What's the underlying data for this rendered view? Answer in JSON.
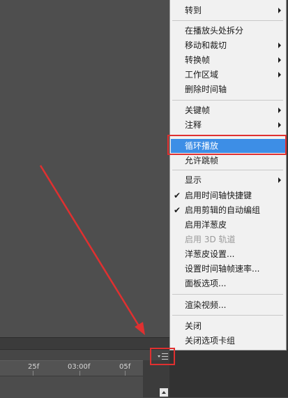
{
  "menu": {
    "groups": [
      {
        "items": [
          {
            "label": "转到",
            "submenu": true
          }
        ]
      },
      {
        "items": [
          {
            "label": "在播放头处拆分"
          },
          {
            "label": "移动和裁切",
            "submenu": true
          },
          {
            "label": "转换帧",
            "submenu": true
          },
          {
            "label": "工作区域",
            "submenu": true
          },
          {
            "label": "删除时间轴"
          }
        ]
      },
      {
        "items": [
          {
            "label": "关键帧",
            "submenu": true
          },
          {
            "label": "注释",
            "submenu": true
          }
        ]
      },
      {
        "items": [
          {
            "label": "循环播放",
            "highlighted": true
          },
          {
            "label": "允许跳帧"
          }
        ]
      },
      {
        "items": [
          {
            "label": "显示",
            "submenu": true
          },
          {
            "label": "启用时间轴快捷键",
            "checked": true
          },
          {
            "label": "启用剪辑的自动编组",
            "checked": true
          },
          {
            "label": "启用洋葱皮"
          },
          {
            "label": "启用 3D 轨道",
            "disabled": true
          },
          {
            "label": "洋葱皮设置..."
          },
          {
            "label": "设置时间轴帧速率..."
          },
          {
            "label": "面板选项..."
          }
        ]
      },
      {
        "items": [
          {
            "label": "渲染视频..."
          }
        ]
      },
      {
        "items": [
          {
            "label": "关闭"
          },
          {
            "label": "关闭选项卡组"
          }
        ]
      }
    ],
    "check_glyph": "✔"
  },
  "timeline": {
    "ruler_labels": [
      "25f",
      "03:00f",
      "05f"
    ]
  },
  "icons": {
    "panel_menu": "panel-menu-icon",
    "submenu": "chevron-right-icon",
    "check": "checkmark-icon",
    "scroll_up": "scroll-up-icon"
  },
  "colors": {
    "highlight": "#3d8ee6",
    "annotation": "#e03030",
    "menu_bg": "#f1f1f1"
  }
}
